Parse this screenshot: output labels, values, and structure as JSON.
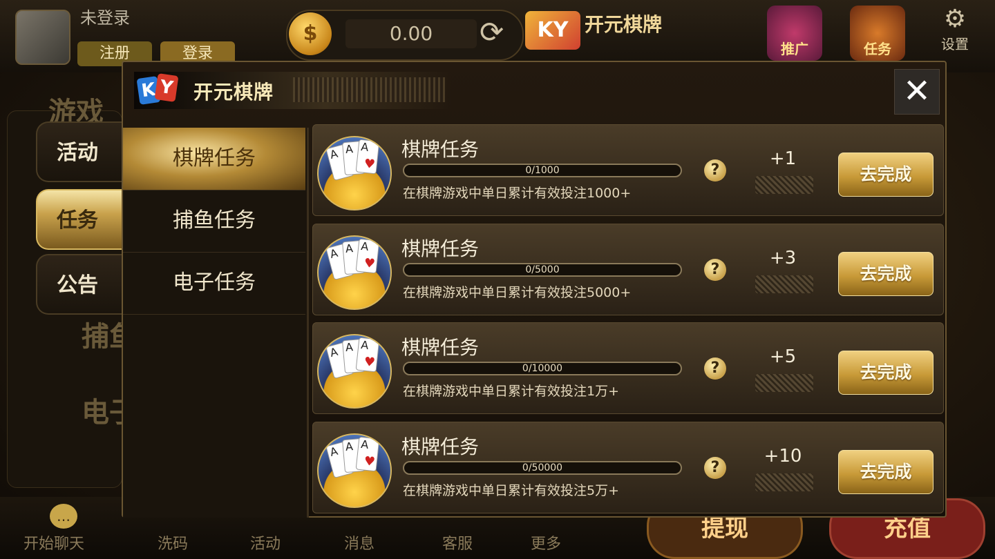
{
  "header": {
    "guest_label": "未登录",
    "register": "注册",
    "login": "登录",
    "balance": "0.00",
    "brand_logo": "KY",
    "brand_name": "开元棋牌",
    "promo_label": "推广",
    "tasks_label": "任务",
    "settings_label": "设置"
  },
  "background": {
    "panel_title": "游戏",
    "fish_partial": "捕鱼",
    "electronic_partial": "电子"
  },
  "side_tabs": [
    {
      "label": "活动",
      "active": false
    },
    {
      "label": "任务",
      "active": true
    },
    {
      "label": "公告",
      "active": false
    }
  ],
  "modal": {
    "logo_k": "K",
    "logo_y": "Y",
    "title": "开元棋牌",
    "close_glyph": "✕",
    "categories": [
      {
        "label": "棋牌任务",
        "active": true
      },
      {
        "label": "捕鱼任务",
        "active": false
      },
      {
        "label": "电子任务",
        "active": false
      }
    ],
    "tasks": [
      {
        "title": "棋牌任务",
        "progress_text": "0/1000",
        "progress": 0,
        "desc": "在棋牌游戏中单日累计有效投注1000+",
        "reward": "+1",
        "button": "去完成"
      },
      {
        "title": "棋牌任务",
        "progress_text": "0/5000",
        "progress": 0,
        "desc": "在棋牌游戏中单日累计有效投注5000+",
        "reward": "+3",
        "button": "去完成"
      },
      {
        "title": "棋牌任务",
        "progress_text": "0/10000",
        "progress": 0,
        "desc": "在棋牌游戏中单日累计有效投注1万+",
        "reward": "+5",
        "button": "去完成"
      },
      {
        "title": "棋牌任务",
        "progress_text": "0/50000",
        "progress": 0,
        "desc": "在棋牌游戏中单日累计有效投注5万+",
        "reward": "+10",
        "button": "去完成"
      }
    ],
    "card_rank": "A",
    "help_glyph": "?"
  },
  "bottom_bar": {
    "chat": "开始聊天",
    "wash": "洗码",
    "activity": "活动",
    "message": "消息",
    "service": "客服",
    "more": "更多",
    "withdraw": "提现",
    "recharge": "充值"
  },
  "colors": {
    "gold": "#c9a24c",
    "panel": "#1a140c",
    "button_text": "#fff8e0"
  }
}
